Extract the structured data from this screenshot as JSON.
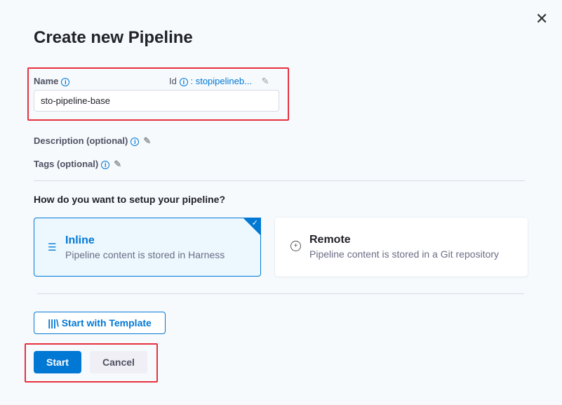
{
  "dialog": {
    "title": "Create new Pipeline",
    "close_icon": "close-icon"
  },
  "name_field": {
    "label": "Name",
    "id_label": "Id",
    "id_sep": ":",
    "id_value": "stopipelineb...",
    "value": "sto-pipeline-base"
  },
  "description": {
    "label": "Description (optional)"
  },
  "tags": {
    "label": "Tags (optional)"
  },
  "setup": {
    "question": "How do you want to setup your pipeline?",
    "options": [
      {
        "title": "Inline",
        "desc": "Pipeline content is stored in Harness",
        "selected": true,
        "icon": "stored-in-harness-icon"
      },
      {
        "title": "Remote",
        "desc": "Pipeline content is stored in a Git repository",
        "selected": false,
        "icon": "git-remote-icon"
      }
    ]
  },
  "template_button": {
    "icon": "|||\\",
    "label": "Start with Template"
  },
  "actions": {
    "start": "Start",
    "cancel": "Cancel"
  },
  "colors": {
    "primary": "#0278d5",
    "highlight": "#e8303f"
  }
}
